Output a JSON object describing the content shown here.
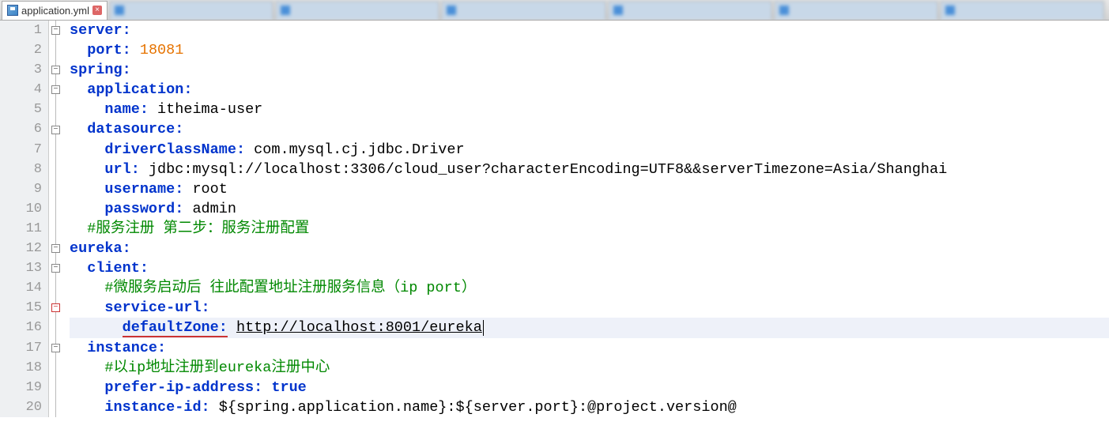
{
  "tabs": {
    "active_name": "application.yml",
    "blurred_count": 6
  },
  "gutter": [
    "1",
    "2",
    "3",
    "4",
    "5",
    "6",
    "7",
    "8",
    "9",
    "10",
    "11",
    "12",
    "13",
    "14",
    "15",
    "16",
    "17",
    "18",
    "19",
    "20"
  ],
  "fold_markers": [
    {
      "line": 1,
      "sym": "−"
    },
    {
      "line": 3,
      "sym": "−"
    },
    {
      "line": 4,
      "sym": "−"
    },
    {
      "line": 6,
      "sym": "−"
    },
    {
      "line": 12,
      "sym": "−"
    },
    {
      "line": 13,
      "sym": "−"
    },
    {
      "line": 15,
      "sym": "−",
      "red": true
    },
    {
      "line": 17,
      "sym": "−"
    }
  ],
  "code": {
    "l1": {
      "k": "server:"
    },
    "l2": {
      "k": "port:",
      "v": "18081"
    },
    "l3": {
      "k": "spring:"
    },
    "l4": {
      "k": "application:"
    },
    "l5": {
      "k": "name:",
      "v": "itheima-user"
    },
    "l6": {
      "k": "datasource:"
    },
    "l7": {
      "k": "driverClassName:",
      "v": "com.mysql.cj.jdbc.Driver"
    },
    "l8": {
      "k": "url:",
      "v": "jdbc:mysql://localhost:3306/cloud_user?characterEncoding=UTF8&&serverTimezone=Asia/Shanghai"
    },
    "l9": {
      "k": "username:",
      "v": "root"
    },
    "l10": {
      "k": "password:",
      "v": "admin"
    },
    "l11": {
      "c": "#服务注册 第二步：服务注册配置"
    },
    "l12": {
      "k": "eureka:"
    },
    "l13": {
      "k": "client:"
    },
    "l14": {
      "c": "#微服务启动后 往此配置地址注册服务信息（ip port）"
    },
    "l15": {
      "k": "service-url:"
    },
    "l16": {
      "k": "defaultZone:",
      "u": "http://localhost:8001/eureka"
    },
    "l17": {
      "k": "instance:"
    },
    "l18": {
      "c": "#以ip地址注册到eureka注册中心"
    },
    "l19": {
      "k": "prefer-ip-address:",
      "kv": "true"
    },
    "l20": {
      "k": "instance-id:",
      "v": "${spring.application.name}:${server.port}:@project.version@"
    }
  },
  "indents": {
    "l1": "",
    "l2": "  ",
    "l3": "",
    "l4": "  ",
    "l5": "    ",
    "l6": "  ",
    "l7": "    ",
    "l8": "    ",
    "l9": "    ",
    "l10": "    ",
    "l11": "  ",
    "l12": "",
    "l13": "  ",
    "l14": "    ",
    "l15": "    ",
    "l16": "      ",
    "l17": "  ",
    "l18": "    ",
    "l19": "    ",
    "l20": "    "
  },
  "current_line": 16
}
